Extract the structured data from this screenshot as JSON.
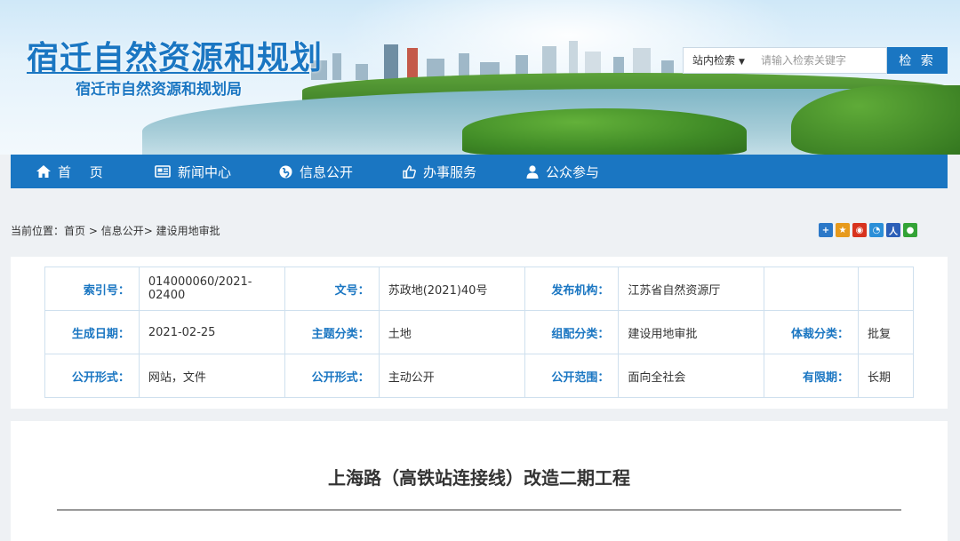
{
  "header": {
    "site_title": "宿迁自然资源和规划",
    "site_subtitle": "宿迁市自然资源和规划局"
  },
  "search": {
    "scope": "站内检索",
    "placeholder": "请输入检索关键字",
    "button": "检 索"
  },
  "nav": {
    "items": [
      {
        "label": "首 页",
        "icon": "home-icon"
      },
      {
        "label": "新闻中心",
        "icon": "newspaper-icon"
      },
      {
        "label": "信息公开",
        "icon": "globe-icon"
      },
      {
        "label": "办事服务",
        "icon": "thumbs-up-icon"
      },
      {
        "label": "公众参与",
        "icon": "user-icon"
      }
    ]
  },
  "breadcrumb": {
    "prefix": "当前位置：",
    "home": "首页",
    "sep1": " > ",
    "section": "信息公开",
    "sep2": "> ",
    "current": "建设用地审批"
  },
  "share": {
    "icons": [
      "share-plus-icon",
      "qzone-icon",
      "weibo-icon",
      "tencent-weibo-icon",
      "renren-icon",
      "wechat-icon"
    ],
    "colors": [
      "#2b78c8",
      "#e79a1c",
      "#d8331e",
      "#2b8fd8",
      "#2b5fb8",
      "#33a336"
    ]
  },
  "meta": {
    "index_label": "索引号：",
    "index_value": "014000060/2021-02400",
    "docno_label": "文号：",
    "docno_value": "苏政地(2021)40号",
    "org_label": "发布机构：",
    "org_value": "江苏省自然资源厅",
    "date_label": "生成日期：",
    "date_value": "2021-02-25",
    "topic_label": "主题分类：",
    "topic_value": "土地",
    "group_label": "组配分类：",
    "group_value": "建设用地审批",
    "genre_label": "体裁分类：",
    "genre_value": "批复",
    "form_label": "公开形式：",
    "form_value": "网站，文件",
    "form2_label": "公开形式：",
    "form2_value": "主动公开",
    "scope_label": "公开范围：",
    "scope_value": "面向全社会",
    "valid_label": "有限期：",
    "valid_value": "长期"
  },
  "article": {
    "title": "上海路（高铁站连接线）改造二期工程"
  }
}
